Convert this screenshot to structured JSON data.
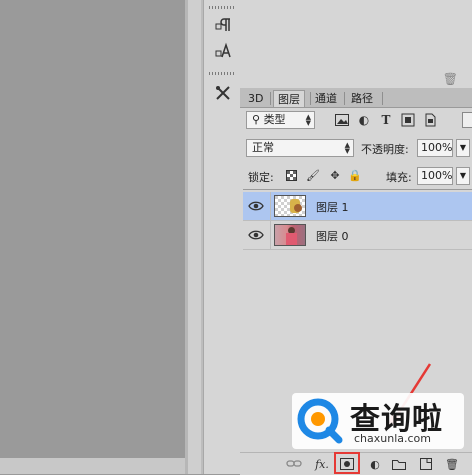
{
  "tabs": [
    "3D",
    "图层",
    "通道",
    "路径"
  ],
  "filter": {
    "kind_label": "类型",
    "search_icon": "search-icon"
  },
  "blend": {
    "mode": "正常",
    "opacity_label": "不透明度:",
    "opacity_value": "100%"
  },
  "lock": {
    "label": "锁定:",
    "fill_label": "填充:",
    "fill_value": "100%"
  },
  "layers": [
    {
      "name": "图层 1",
      "selected": true
    },
    {
      "name": "图层 0",
      "selected": false
    }
  ],
  "footer": {
    "fx_label": "fx."
  },
  "watermark": {
    "brand": "查询啦",
    "domain": "chaxunla.com"
  },
  "colors": {
    "selection": "#adc6f0",
    "highlight_red": "#e53935",
    "panel": "#d6d6d6",
    "canvas": "#9a9a9a"
  }
}
